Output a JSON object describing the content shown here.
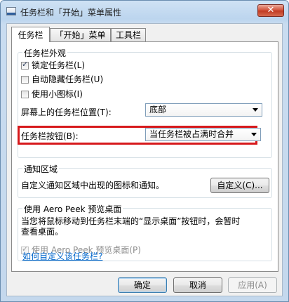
{
  "window": {
    "title": "任务栏和「开始」菜单属性",
    "close_glyph": "✕"
  },
  "tabs": [
    {
      "label": "任务栏",
      "selected": true
    },
    {
      "label": "「开始」菜单",
      "selected": false
    },
    {
      "label": "工具栏",
      "selected": false
    }
  ],
  "appearance": {
    "group_title": "任务栏外观",
    "lock_label": "锁定任务栏(L)",
    "lock_checked": true,
    "autohide_label": "自动隐藏任务栏(U)",
    "autohide_checked": false,
    "small_icons_label": "使用小图标(I)",
    "small_icons_checked": false,
    "position_label": "屏幕上的任务栏位置(T):",
    "position_value": "底部",
    "buttons_label": "任务栏按钮(B):",
    "buttons_value": "当任务栏被占满时合并"
  },
  "notification": {
    "group_title": "通知区域",
    "description": "自定义通知区域中出现的图标和通知。",
    "customize_button": "自定义(C)..."
  },
  "aero_peek": {
    "group_title": "使用 Aero Peek 预览桌面",
    "description_line1": "当您将鼠标移动到任务栏末端的“显示桌面”按钮时，会暂时",
    "description_line2": "查看桌面。",
    "checkbox_label": "使用 Aero Peek 预览桌面(P)",
    "checkbox_checked": true,
    "checkbox_enabled": false
  },
  "help_link": "如何自定义该任务栏?",
  "buttons": {
    "ok": "确定",
    "cancel": "取消",
    "apply": "应用(A)"
  },
  "colors": {
    "highlight": "#d7191c",
    "link": "#0066cc",
    "close_button": "#c13c24"
  }
}
